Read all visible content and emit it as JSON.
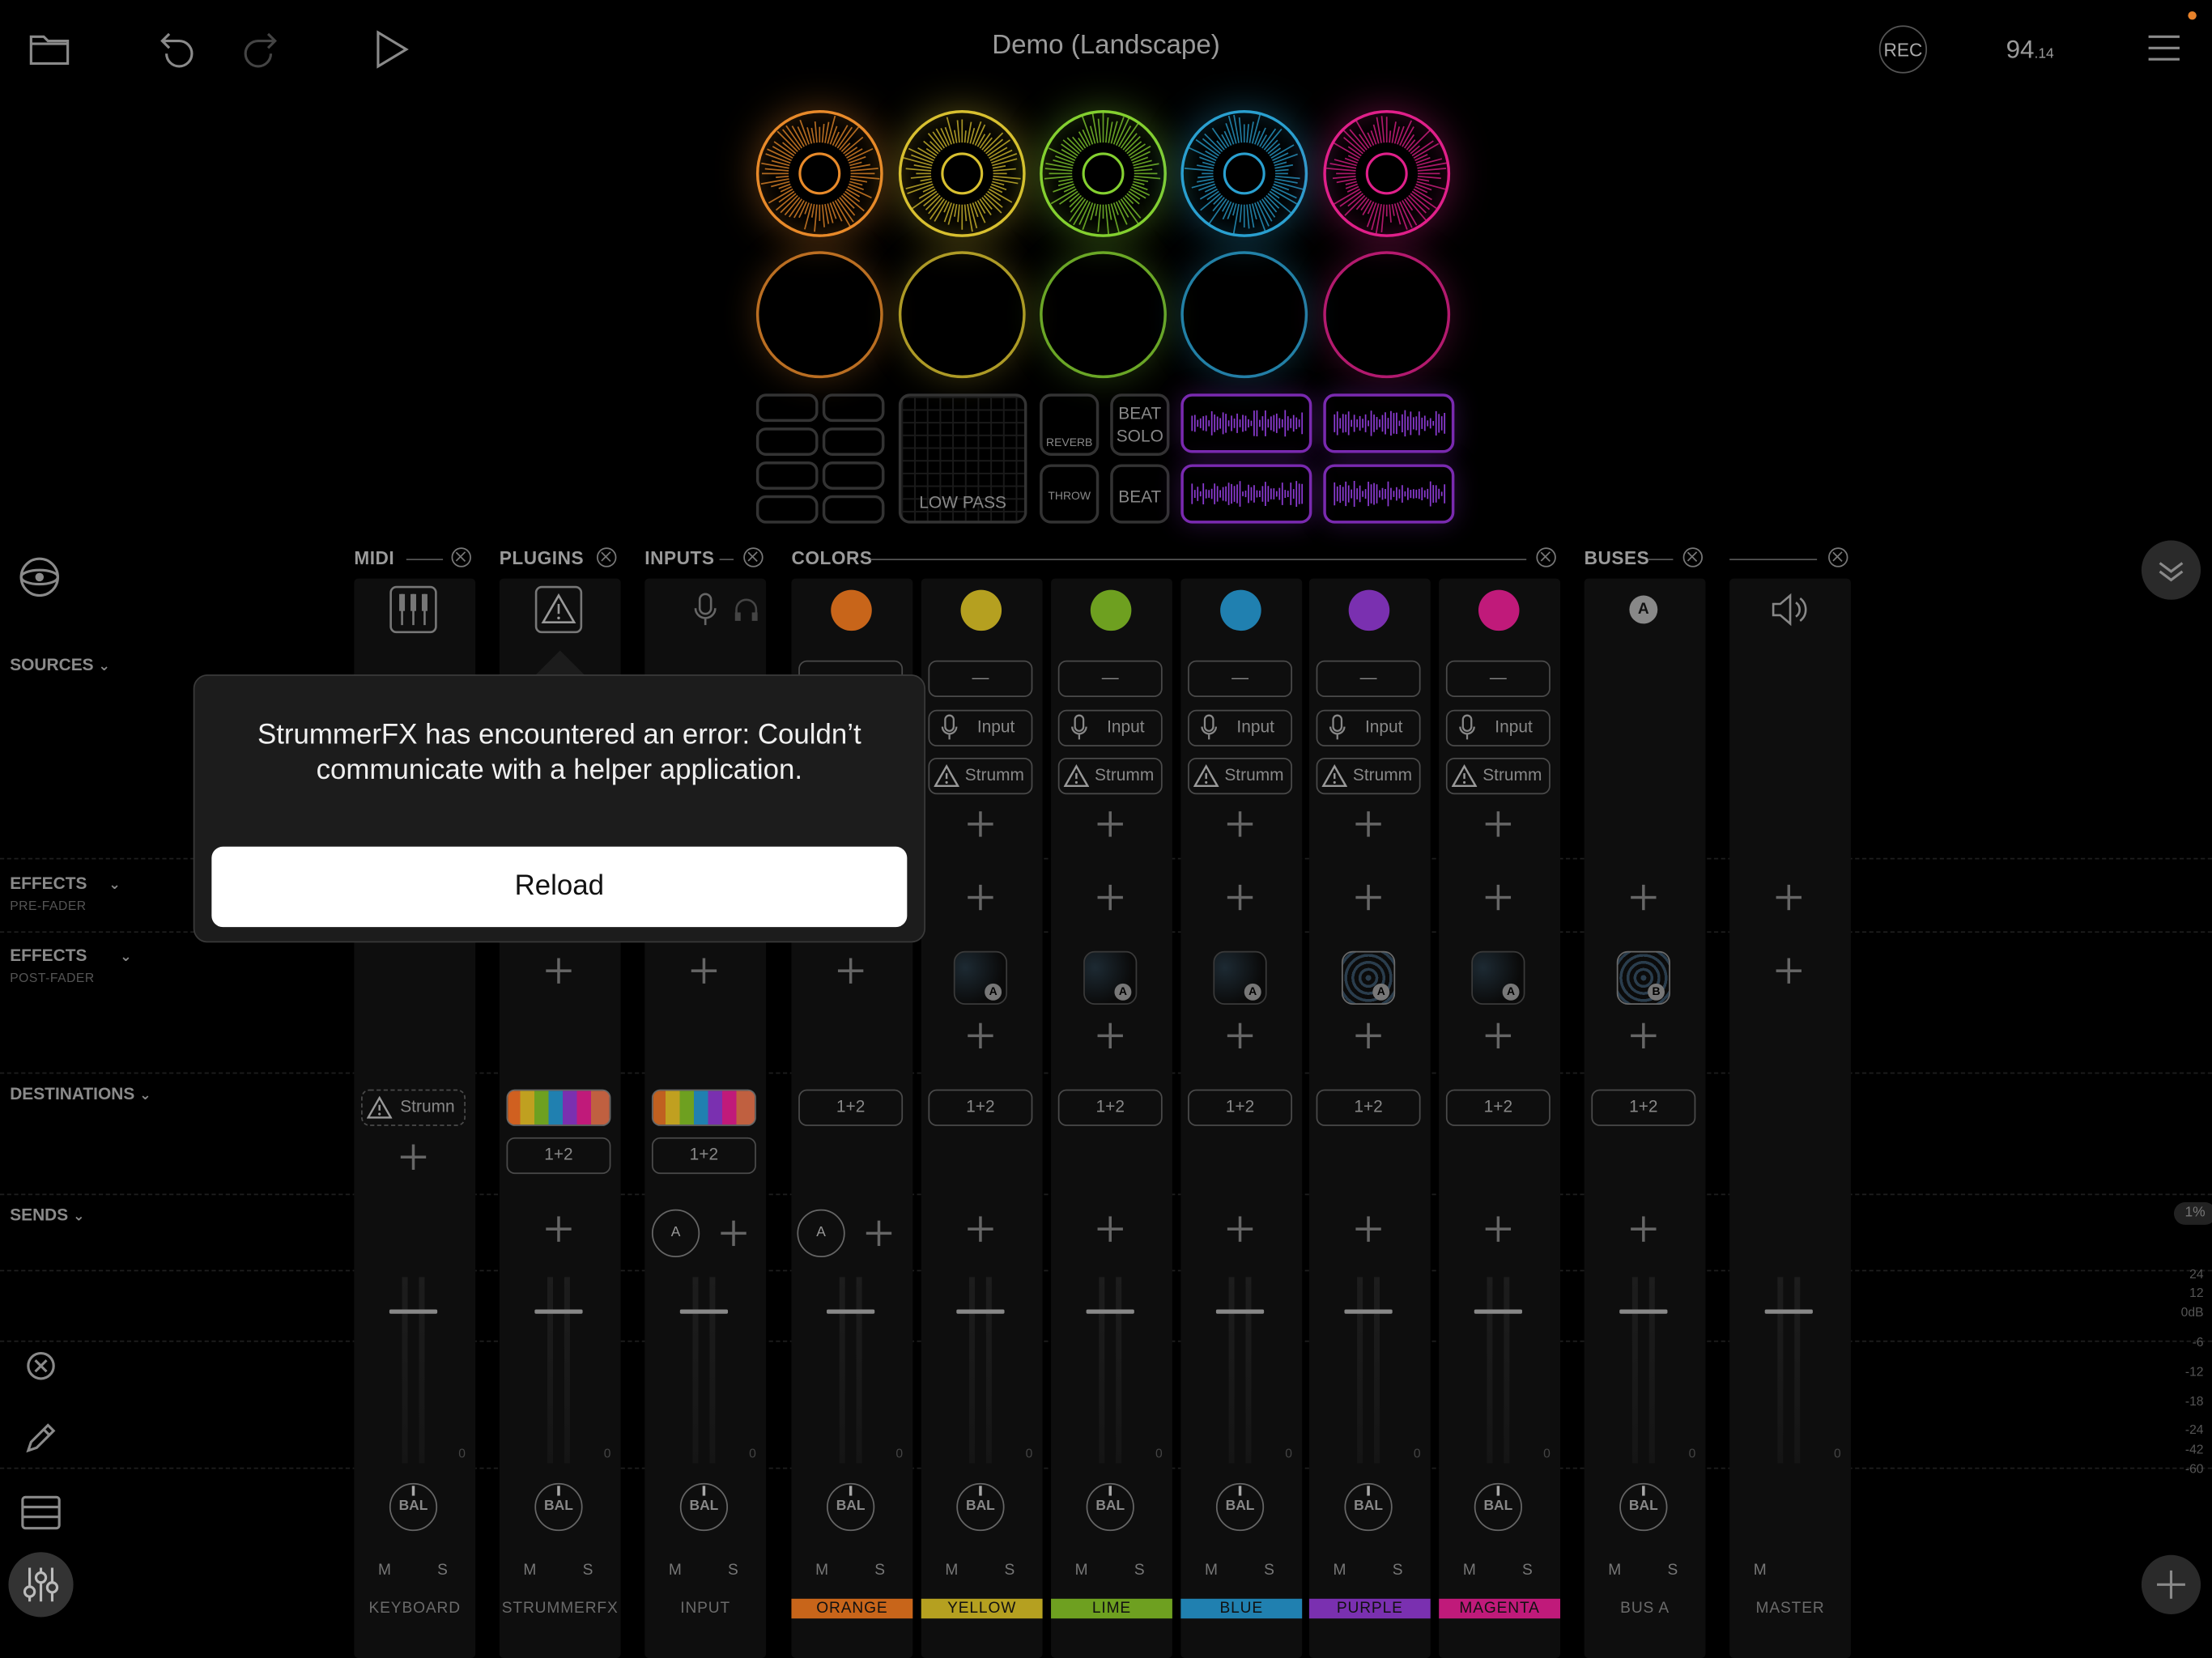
{
  "header": {
    "title": "Demo (Landscape)",
    "rec_label": "REC",
    "tempo": "94",
    "tempo_decimal": ".14"
  },
  "pads": {
    "colors": [
      "#e88a2a",
      "#d8c030",
      "#84d030",
      "#2aa0d0",
      "#e0208a"
    ],
    "rect_labels": {
      "reverb": "REVERB",
      "beat_solo": "BEAT SOLO",
      "low_pass": "LOW PASS",
      "throw": "THROW",
      "beat": "BEAT"
    }
  },
  "sections": {
    "midi": "MIDI",
    "plugins": "PLUGINS",
    "inputs": "INPUTS",
    "colors": "COLORS",
    "buses": "BUSES"
  },
  "rows": {
    "sources": "SOURCES",
    "effects_pre": "EFFECTS",
    "effects_pre_sub": "PRE-FADER",
    "effects_post": "EFFECTS",
    "effects_post_sub": "POST-FADER",
    "destinations": "DESTINATIONS",
    "sends": "SENDS"
  },
  "slots": {
    "empty": "—",
    "input": "Input",
    "strummer": "Strumm",
    "strummer_dest": "Strumn",
    "output": "1+2",
    "send_a": "A",
    "bus_a_badge": "A",
    "fx_a": "A",
    "fx_b": "B",
    "zero": "0",
    "cpu": "1%"
  },
  "channels": [
    {
      "name": "KEYBOARD",
      "color": ""
    },
    {
      "name": "STRUMMERFX",
      "color": ""
    },
    {
      "name": "INPUT",
      "color": ""
    },
    {
      "name": "ORANGE",
      "color": "#c8651a"
    },
    {
      "name": "YELLOW",
      "color": "#b5a020"
    },
    {
      "name": "LIME",
      "color": "#6ea020"
    },
    {
      "name": "BLUE",
      "color": "#2080b0"
    },
    {
      "name": "PURPLE",
      "color": "#7a30b0"
    },
    {
      "name": "MAGENTA",
      "color": "#c01a7a"
    },
    {
      "name": "BUS A",
      "color": ""
    },
    {
      "name": "MASTER",
      "color": ""
    }
  ],
  "dot_colors": [
    "#c8651a",
    "#b5a020",
    "#6ea020",
    "#2080b0",
    "#7a30b0",
    "#c01a7a"
  ],
  "bal_label": "BAL",
  "mute_label": "M",
  "solo_label": "S",
  "db_scale": [
    "24",
    "12",
    "0dB",
    "-6",
    "-12",
    "-18",
    "-24",
    "-42",
    "-60"
  ],
  "popup": {
    "message": "StrummerFX has encountered an error: Couldn’t communicate with a helper application.",
    "button": "Reload"
  }
}
